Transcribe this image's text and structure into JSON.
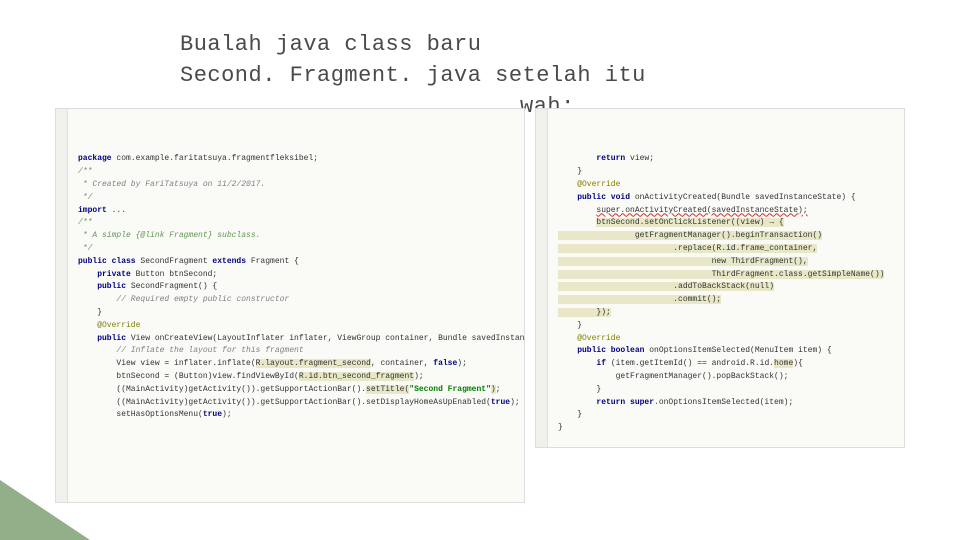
{
  "heading": {
    "line1": "Bualah java class baru",
    "line2": "Second. Fragment. java setelah itu",
    "line3_fragment": "wah:"
  },
  "code_left": [
    {
      "cls": "kw",
      "t": "package"
    },
    {
      "t": " com.example.faritatsuya.fragmentfleksibel;"
    },
    {
      "br": 1
    },
    {
      "br": 1
    },
    {
      "cls": "comment",
      "t": "/**"
    },
    {
      "br": 1
    },
    {
      "cls": "comment",
      "t": " * Created by FariTatsuya on 11/2/2017."
    },
    {
      "br": 1
    },
    {
      "cls": "comment",
      "t": " */"
    },
    {
      "br": 1
    },
    {
      "br": 1
    },
    {
      "cls": "kw",
      "t": "import"
    },
    {
      "t": " ..."
    },
    {
      "br": 1
    },
    {
      "br": 1
    },
    {
      "cls": "doccomment",
      "t": "/**"
    },
    {
      "br": 1
    },
    {
      "cls": "doccomment",
      "t": " * A simple {@link Fragment} subclass."
    },
    {
      "br": 1
    },
    {
      "cls": "doccomment",
      "t": " */"
    },
    {
      "br": 1
    },
    {
      "cls": "kw",
      "t": "public class"
    },
    {
      "t": " SecondFragment "
    },
    {
      "cls": "kw",
      "t": "extends"
    },
    {
      "t": " Fragment {"
    },
    {
      "br": 1
    },
    {
      "br": 1
    },
    {
      "t": "    "
    },
    {
      "cls": "kw",
      "t": "private"
    },
    {
      "t": " Button btnSecond;"
    },
    {
      "br": 1
    },
    {
      "br": 1
    },
    {
      "t": "    "
    },
    {
      "cls": "kw",
      "t": "public"
    },
    {
      "t": " SecondFragment() {"
    },
    {
      "br": 1
    },
    {
      "t": "        "
    },
    {
      "cls": "comment",
      "t": "// Required empty public constructor"
    },
    {
      "br": 1
    },
    {
      "t": "    }"
    },
    {
      "br": 1
    },
    {
      "br": 1
    },
    {
      "br": 1
    },
    {
      "t": "    "
    },
    {
      "cls": "ann",
      "t": "@Override"
    },
    {
      "br": 1
    },
    {
      "t": "    "
    },
    {
      "cls": "kw",
      "t": "public"
    },
    {
      "t": " View onCreateView(LayoutInflater inflater, ViewGroup container, Bundle savedInstanceState) {"
    },
    {
      "br": 1
    },
    {
      "br": 1
    },
    {
      "t": "        "
    },
    {
      "cls": "comment",
      "t": "// Inflate the layout for this fragment"
    },
    {
      "br": 1
    },
    {
      "t": "        View view = inflater.inflate("
    },
    {
      "cls": "hl",
      "t": "R.layout.fragment_second"
    },
    {
      "t": ", container, "
    },
    {
      "cls": "kw",
      "t": "false"
    },
    {
      "t": ");"
    },
    {
      "br": 1
    },
    {
      "t": "        btnSecond = (Button)view.findViewById("
    },
    {
      "cls": "hl",
      "t": "R.id.btn_second_fragment"
    },
    {
      "t": ");"
    },
    {
      "br": 1
    },
    {
      "br": 1
    },
    {
      "t": "        ((MainActivity)getActivity()).getSupportActionBar()."
    },
    {
      "cls": "hl",
      "t": "setTitle("
    },
    {
      "cls": "string",
      "t": "\"Second Fragment\""
    },
    {
      "cls": "hl",
      "t": ")"
    },
    {
      "t": ";"
    },
    {
      "br": 1
    },
    {
      "t": "        ((MainActivity)getActivity()).getSupportActionBar().setDisplayHomeAsUpEnabled("
    },
    {
      "cls": "kw",
      "t": "true"
    },
    {
      "t": ");"
    },
    {
      "br": 1
    },
    {
      "br": 1
    },
    {
      "t": "        setHasOptionsMenu("
    },
    {
      "cls": "kw",
      "t": "true"
    },
    {
      "t": ");"
    },
    {
      "br": 1
    }
  ],
  "code_right": [
    {
      "t": "        "
    },
    {
      "cls": "kw",
      "t": "return"
    },
    {
      "t": " view;"
    },
    {
      "br": 1
    },
    {
      "t": "    }"
    },
    {
      "br": 1
    },
    {
      "br": 1
    },
    {
      "t": "    "
    },
    {
      "cls": "ann",
      "t": "@Override"
    },
    {
      "br": 1
    },
    {
      "t": "    "
    },
    {
      "cls": "kw",
      "t": "public void"
    },
    {
      "t": " onActivityCreated(Bundle savedInstanceState) {"
    },
    {
      "br": 1
    },
    {
      "t": "        "
    },
    {
      "cls": "err",
      "t": "super.onActivityCreated(savedInstanceState);"
    },
    {
      "br": 1
    },
    {
      "br": 1
    },
    {
      "t": "        "
    },
    {
      "cls": "hl",
      "t": "btnSecond.setOnClickListener((view) → {"
    },
    {
      "br": 1
    },
    {
      "cls": "hl",
      "t": "                getFragmentManager().beginTransaction()"
    },
    {
      "br": 1
    },
    {
      "cls": "hl",
      "t": "                        .replace(R.id.frame_container,"
    },
    {
      "br": 1
    },
    {
      "cls": "hl",
      "t": "                                new ThirdFragment(),"
    },
    {
      "br": 1
    },
    {
      "cls": "hl",
      "t": "                                ThirdFragment.class.getSimpleName())"
    },
    {
      "br": 1
    },
    {
      "cls": "hl",
      "t": "                        .addToBackStack(null)"
    },
    {
      "br": 1
    },
    {
      "cls": "hl",
      "t": "                        .commit();"
    },
    {
      "br": 1
    },
    {
      "br": 1
    },
    {
      "cls": "hl",
      "t": "        });"
    },
    {
      "br": 1
    },
    {
      "t": "    }"
    },
    {
      "br": 1
    },
    {
      "br": 1
    },
    {
      "t": "    "
    },
    {
      "cls": "ann",
      "t": "@Override"
    },
    {
      "br": 1
    },
    {
      "t": "    "
    },
    {
      "cls": "kw",
      "t": "public boolean"
    },
    {
      "t": " onOptionsItemSelected(MenuItem item) {"
    },
    {
      "br": 1
    },
    {
      "t": "        "
    },
    {
      "cls": "kw",
      "t": "if"
    },
    {
      "t": " (item.getItemId() == android.R.id."
    },
    {
      "cls": "hl",
      "t": "home"
    },
    {
      "t": "){"
    },
    {
      "br": 1
    },
    {
      "t": "            getFragmentManager().popBackStack();"
    },
    {
      "br": 1
    },
    {
      "t": "        }"
    },
    {
      "br": 1
    },
    {
      "t": "        "
    },
    {
      "cls": "kw",
      "t": "return super"
    },
    {
      "t": ".onOptionsItemSelected(item);"
    },
    {
      "br": 1
    },
    {
      "t": "    }"
    },
    {
      "br": 1
    },
    {
      "br": 1
    },
    {
      "t": "}"
    },
    {
      "br": 1
    }
  ]
}
